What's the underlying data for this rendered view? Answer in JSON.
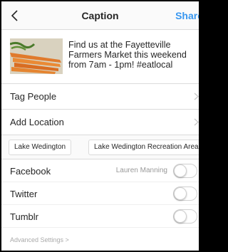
{
  "nav": {
    "title": "Caption",
    "share_label": "Share",
    "back_icon": "chevron-left-icon"
  },
  "post": {
    "caption_lines": [
      "Find us at the Fayetteville",
      "Farmers Market this weekend",
      "from 7am - 1pm! #eatlocal"
    ],
    "thumbnail": "carrots-photo"
  },
  "options": {
    "tag_people": "Tag People",
    "add_location": "Add Location"
  },
  "location_suggestions": [
    "Lake Wedington",
    "Lake Wedington Recreation Area"
  ],
  "share_targets": [
    {
      "label": "Facebook",
      "account": "Lauren Manning",
      "enabled": false
    },
    {
      "label": "Twitter",
      "account": "",
      "enabled": false
    },
    {
      "label": "Tumblr",
      "account": "",
      "enabled": false
    }
  ],
  "advanced_settings": "Advanced Settings >",
  "colors": {
    "accent": "#3897f0",
    "divider": "#dbdbdb",
    "text": "#262626"
  }
}
